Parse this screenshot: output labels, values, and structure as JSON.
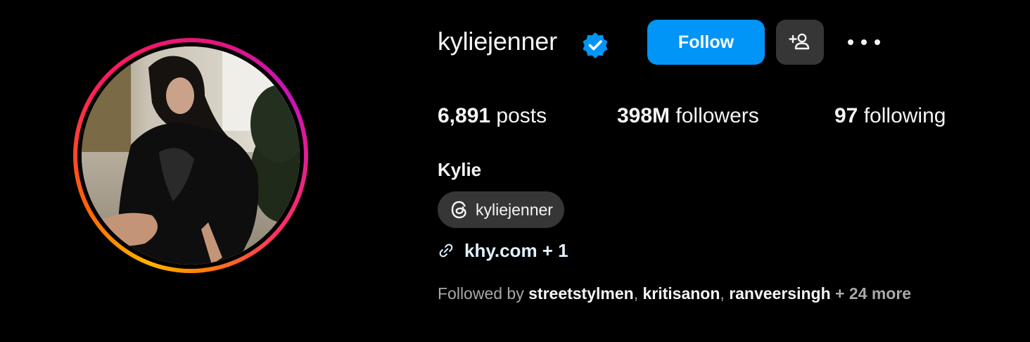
{
  "profile": {
    "username": "kyliejenner",
    "full_name": "Kylie",
    "verified": true
  },
  "actions": {
    "follow_label": "Follow",
    "suggest_icon": "add-person-icon",
    "more_icon": "more-horizontal-icon"
  },
  "stats": {
    "posts_count": "6,891",
    "posts_label": "posts",
    "followers_count": "398M",
    "followers_label": "followers",
    "following_count": "97",
    "following_label": "following"
  },
  "threads": {
    "icon": "threads-icon",
    "handle": "kyliejenner"
  },
  "link": {
    "icon": "link-icon",
    "text": "khy.com + 1"
  },
  "followed_by": {
    "prefix": "Followed by ",
    "names": [
      "streetstylmen",
      "kritisanon",
      "ranveersingh"
    ],
    "separator": ", ",
    "suffix": " + 24 more"
  },
  "colors": {
    "background": "#000000",
    "follow_button": "#0095f6",
    "secondary_button": "#363636",
    "verified_badge": "#0095f6",
    "link_text": "#e0f1ff",
    "muted_text": "#a8a8a8"
  }
}
